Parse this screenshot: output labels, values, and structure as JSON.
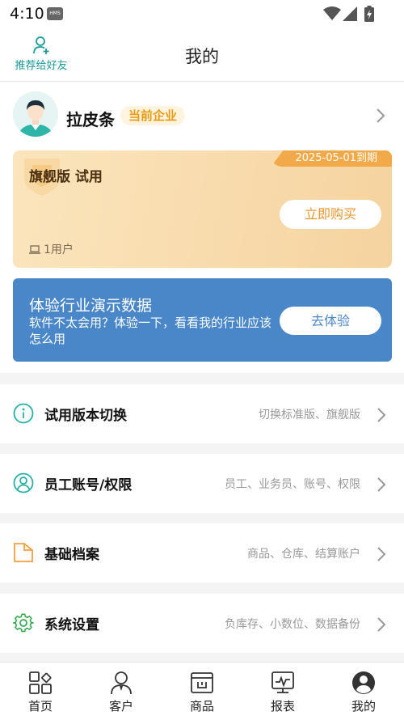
{
  "status_bar": {
    "time": "4:10",
    "hms_badge": "HMS"
  },
  "header": {
    "recommend_label": "推荐给好友",
    "title": "我的"
  },
  "profile": {
    "name": "拉皮条",
    "company_badge": "当前企业"
  },
  "plan": {
    "expiry": "2025-05-01到期",
    "name": "旗舰版 试用",
    "buy_label": "立即购买",
    "users": "1用户"
  },
  "demo": {
    "title": "体验行业演示数据",
    "description": "软件不太会用？体验一下，看看我的行业应该怎么用",
    "button": "去体验"
  },
  "menu": [
    {
      "icon": "info-icon",
      "label": "试用版本切换",
      "hint": "切换标准版、旗舰版"
    },
    {
      "icon": "user-circle-icon",
      "label": "员工账号/权限",
      "hint": "员工、业务员、账号、权限"
    },
    {
      "icon": "folder-icon",
      "label": "基础档案",
      "hint": "商品、仓库、结算账户"
    },
    {
      "icon": "gear-icon",
      "label": "系统设置",
      "hint": "负库存、小数位、数据备份"
    }
  ],
  "tabs": [
    {
      "icon": "home-grid-icon",
      "label": "首页"
    },
    {
      "icon": "customer-icon",
      "label": "客户"
    },
    {
      "icon": "goods-icon",
      "label": "商品"
    },
    {
      "icon": "report-icon",
      "label": "报表"
    },
    {
      "icon": "mine-icon",
      "label": "我的"
    }
  ],
  "colors": {
    "accent_teal": "#1a9a9a",
    "badge_orange": "#e89a12",
    "demo_blue": "#4a87c8",
    "menu_orange": "#f0a040",
    "menu_green": "#3aa852"
  }
}
